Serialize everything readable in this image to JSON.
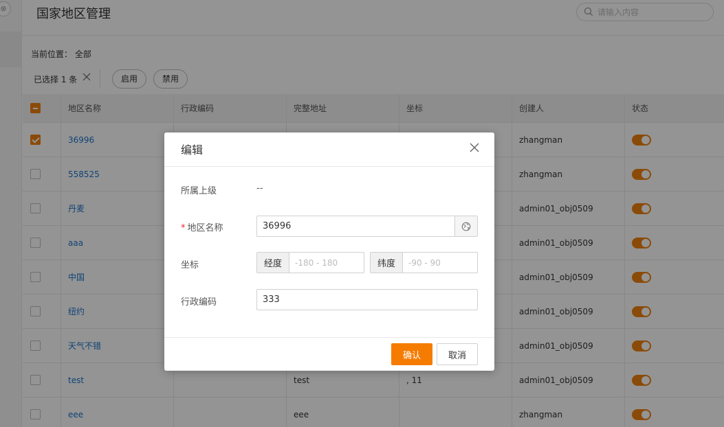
{
  "page": {
    "title": "国家地区管理"
  },
  "search": {
    "placeholder": "请输入内容"
  },
  "breadcrumb": {
    "label": "当前位置：",
    "value": "全部"
  },
  "toolbar": {
    "selected_text": "已选择 1 条",
    "enable_label": "启用",
    "disable_label": "禁用"
  },
  "table": {
    "headers": [
      "地区名称",
      "行政编码",
      "完整地址",
      "坐标",
      "创建人",
      "状态"
    ],
    "rows": [
      {
        "name": "36996",
        "code": "",
        "address": "",
        "coords": "",
        "creator": "zhangman",
        "checked": true,
        "enabled": true
      },
      {
        "name": "558525",
        "code": "",
        "address": "",
        "coords": "",
        "creator": "zhangman",
        "checked": false,
        "enabled": true
      },
      {
        "name": "丹麦",
        "code": "",
        "address": "",
        "coords": "",
        "creator": "admin01_obj0509",
        "checked": false,
        "enabled": true
      },
      {
        "name": "aaa",
        "code": "",
        "address": "",
        "coords": "",
        "creator": "admin01_obj0509",
        "checked": false,
        "enabled": true
      },
      {
        "name": "中国",
        "code": "",
        "address": "",
        "coords": "",
        "creator": "admin01_obj0509",
        "checked": false,
        "enabled": true
      },
      {
        "name": "纽约",
        "code": "",
        "address": "",
        "coords": "",
        "creator": "admin01_obj0509",
        "checked": false,
        "enabled": true
      },
      {
        "name": "天气不错",
        "code": "",
        "address": "",
        "coords": "",
        "creator": "admin01_obj0509",
        "checked": false,
        "enabled": true
      },
      {
        "name": "test",
        "code": "",
        "address": "test",
        "coords": ", 11",
        "creator": "admin01_obj0509",
        "checked": false,
        "enabled": true
      },
      {
        "name": "eee",
        "code": "",
        "address": "eee",
        "coords": "",
        "creator": "zhangman",
        "checked": false,
        "enabled": true
      }
    ]
  },
  "modal": {
    "title": "编辑",
    "parent_label": "所属上级",
    "parent_value": "--",
    "name_label": "地区名称",
    "required_mark": "*",
    "name_value": "36996",
    "coord_label": "坐标",
    "lng_addon": "经度",
    "lng_placeholder": "-180 - 180",
    "lat_addon": "纬度",
    "lat_placeholder": "-90 - 90",
    "code_label": "行政编码",
    "code_value": "333",
    "confirm_label": "确认",
    "cancel_label": "取消"
  },
  "colors": {
    "accent": "#f57c00",
    "link": "#1a73c8"
  },
  "icons": {
    "search": "search-icon",
    "close": "close-icon",
    "globe": "globe-icon",
    "collapse": "collapse-icon"
  }
}
